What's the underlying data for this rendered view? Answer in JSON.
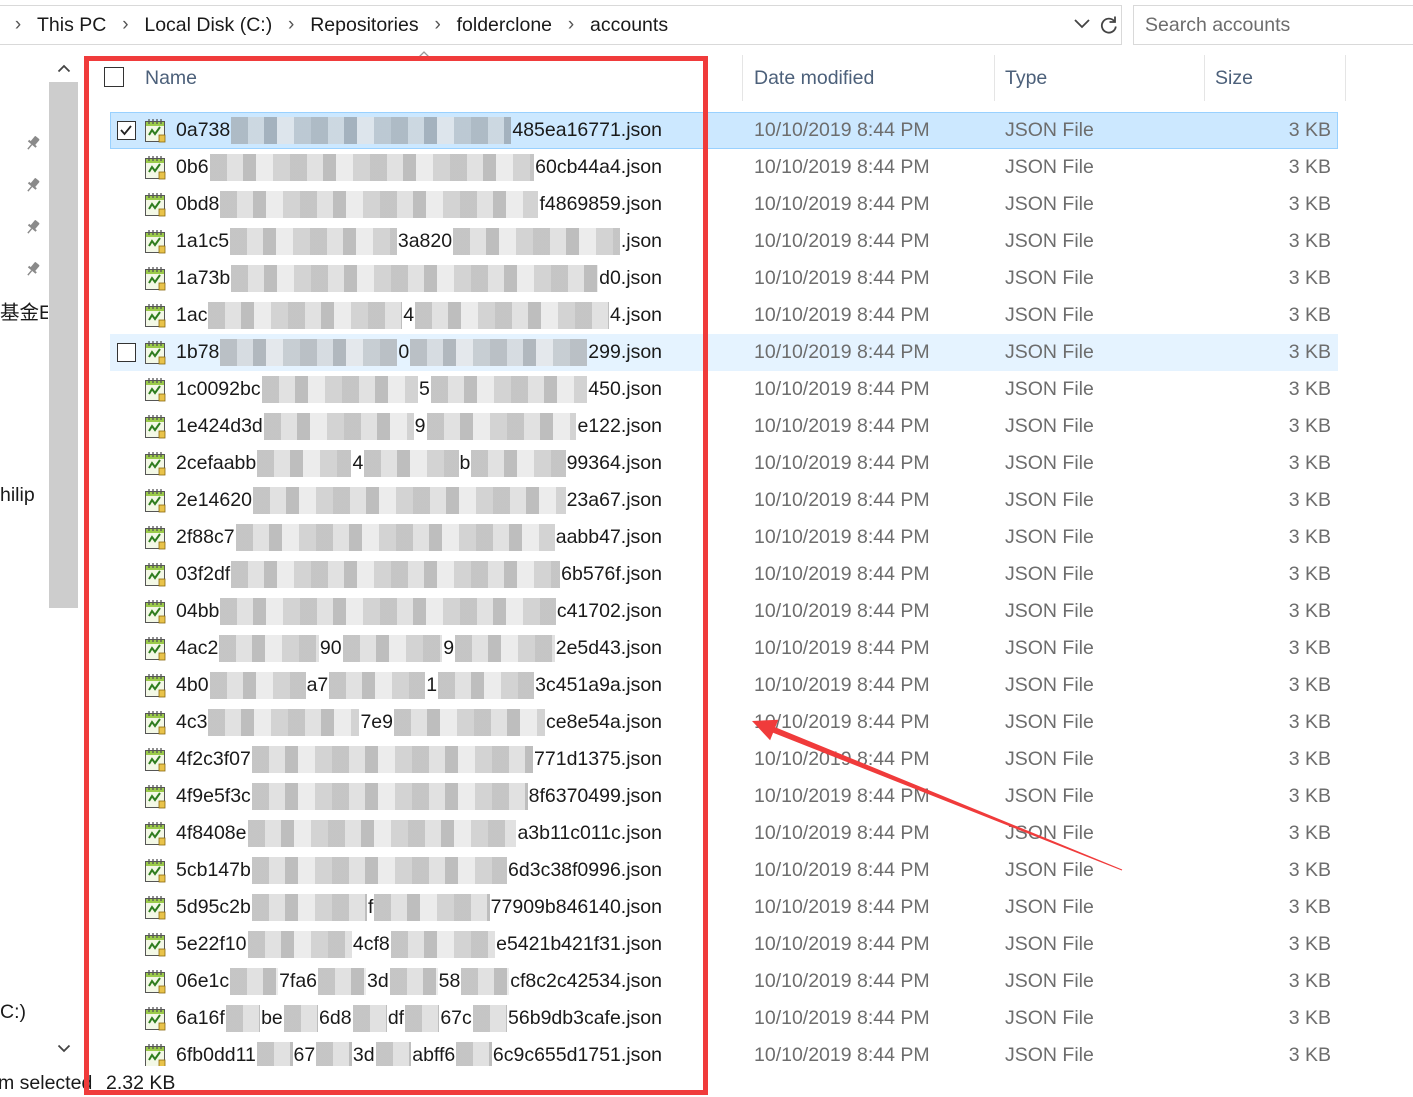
{
  "address_bar": {
    "crumbs": [
      "This PC",
      "Local Disk (C:)",
      "Repositories",
      "folderclone",
      "accounts"
    ],
    "separator_icon": "chevron-right-icon",
    "dropdown_icon": "chevron-down-icon",
    "refresh_icon": "refresh-icon"
  },
  "search": {
    "placeholder": "Search accounts"
  },
  "nav_pane": {
    "pins": [
      "pin-icon",
      "pin-icon",
      "pin-icon",
      "pin-icon"
    ],
    "items": [
      "基金E",
      "hilip",
      "C:)"
    ]
  },
  "columns": {
    "name": "Name",
    "date_modified": "Date modified",
    "type": "Type",
    "size": "Size",
    "sort_icon": "chevron-up-icon"
  },
  "files": [
    {
      "name_parts": [
        "0a738",
        "485ea16771.json"
      ],
      "date": "10/10/2019 8:44 PM",
      "type": "JSON File",
      "size": "3 KB",
      "selected": true
    },
    {
      "name_parts": [
        "0b6",
        "60cb44a4.json"
      ],
      "date": "10/10/2019 8:44 PM",
      "type": "JSON File",
      "size": "3 KB"
    },
    {
      "name_parts": [
        "0bd8",
        "f4869859.json"
      ],
      "date": "10/10/2019 8:44 PM",
      "type": "JSON File",
      "size": "3 KB"
    },
    {
      "name_parts": [
        "1a1c5",
        "3a820",
        ".json"
      ],
      "date": "10/10/2019 8:44 PM",
      "type": "JSON File",
      "size": "3 KB"
    },
    {
      "name_parts": [
        "1a73b",
        "d0.json"
      ],
      "date": "10/10/2019 8:44 PM",
      "type": "JSON File",
      "size": "3 KB"
    },
    {
      "name_parts": [
        "1ac",
        "4",
        "4.json"
      ],
      "date": "10/10/2019 8:44 PM",
      "type": "JSON File",
      "size": "3 KB"
    },
    {
      "name_parts": [
        "1b78",
        "0",
        "299.json"
      ],
      "date": "10/10/2019 8:44 PM",
      "type": "JSON File",
      "size": "3 KB",
      "hover": true
    },
    {
      "name_parts": [
        "1c0092bc",
        "5",
        "450.json"
      ],
      "date": "10/10/2019 8:44 PM",
      "type": "JSON File",
      "size": "3 KB"
    },
    {
      "name_parts": [
        "1e424d3d",
        "9",
        "e122.json"
      ],
      "date": "10/10/2019 8:44 PM",
      "type": "JSON File",
      "size": "3 KB"
    },
    {
      "name_parts": [
        "2cefaabb",
        "4",
        "b",
        "99364.json"
      ],
      "date": "10/10/2019 8:44 PM",
      "type": "JSON File",
      "size": "3 KB"
    },
    {
      "name_parts": [
        "2e14620",
        "23a67.json"
      ],
      "date": "10/10/2019 8:44 PM",
      "type": "JSON File",
      "size": "3 KB"
    },
    {
      "name_parts": [
        "2f88c7",
        "aabb47.json"
      ],
      "date": "10/10/2019 8:44 PM",
      "type": "JSON File",
      "size": "3 KB"
    },
    {
      "name_parts": [
        "03f2df",
        "6b576f.json"
      ],
      "date": "10/10/2019 8:44 PM",
      "type": "JSON File",
      "size": "3 KB"
    },
    {
      "name_parts": [
        "04bb",
        "c41702.json"
      ],
      "date": "10/10/2019 8:44 PM",
      "type": "JSON File",
      "size": "3 KB"
    },
    {
      "name_parts": [
        "4ac2",
        "90",
        "9",
        "2e5d43.json"
      ],
      "date": "10/10/2019 8:44 PM",
      "type": "JSON File",
      "size": "3 KB"
    },
    {
      "name_parts": [
        "4b0",
        "a7",
        "1",
        "3c451a9a.json"
      ],
      "date": "10/10/2019 8:44 PM",
      "type": "JSON File",
      "size": "3 KB"
    },
    {
      "name_parts": [
        "4c3",
        "7e9",
        "ce8e54a.json"
      ],
      "date": "10/10/2019 8:44 PM",
      "type": "JSON File",
      "size": "3 KB"
    },
    {
      "name_parts": [
        "4f2c3f07",
        "771d1375.json"
      ],
      "date": "10/10/2019 8:44 PM",
      "type": "JSON File",
      "size": "3 KB"
    },
    {
      "name_parts": [
        "4f9e5f3c",
        "8f6370499.json"
      ],
      "date": "10/10/2019 8:44 PM",
      "type": "JSON File",
      "size": "3 KB"
    },
    {
      "name_parts": [
        "4f8408e",
        "a3b11c011c.json"
      ],
      "date": "10/10/2019 8:44 PM",
      "type": "JSON File",
      "size": "3 KB"
    },
    {
      "name_parts": [
        "5cb147b",
        "6d3c38f0996.json"
      ],
      "date": "10/10/2019 8:44 PM",
      "type": "JSON File",
      "size": "3 KB"
    },
    {
      "name_parts": [
        "5d95c2b",
        "f",
        "77909b846140.json"
      ],
      "date": "10/10/2019 8:44 PM",
      "type": "JSON File",
      "size": "3 KB"
    },
    {
      "name_parts": [
        "5e22f10",
        "4cf8",
        "e5421b421f31.json"
      ],
      "date": "10/10/2019 8:44 PM",
      "type": "JSON File",
      "size": "3 KB"
    },
    {
      "name_parts": [
        "06e1c",
        "7fa6",
        "3d",
        "58",
        "cf8c2c42534.json"
      ],
      "date": "10/10/2019 8:44 PM",
      "type": "JSON File",
      "size": "3 KB"
    },
    {
      "name_parts": [
        "6a16f",
        "be",
        "6d8",
        "df",
        "67c",
        "56b9db3cafe.json"
      ],
      "date": "10/10/2019 8:44 PM",
      "type": "JSON File",
      "size": "3 KB"
    },
    {
      "name_parts": [
        "6fb0dd11",
        "67",
        "3d",
        "abff6",
        "6c9c655d1751.json"
      ],
      "date": "10/10/2019 8:44 PM",
      "type": "JSON File",
      "size": "3 KB"
    }
  ],
  "status_bar": {
    "selection": "m selected",
    "selected_size": "2.32 KB"
  },
  "theme": {
    "selection": "#cce8ff",
    "selection_border": "#99d1ff",
    "hover": "#e5f3ff",
    "annotation": "#f03b3b"
  }
}
